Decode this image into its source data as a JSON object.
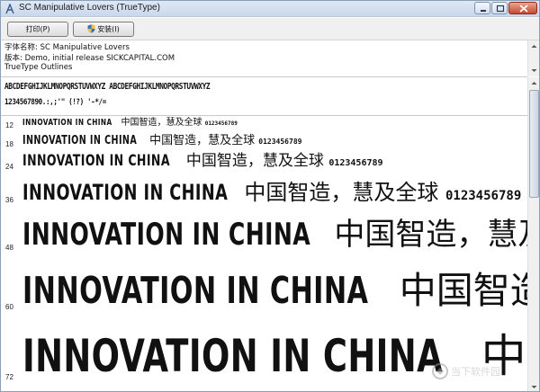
{
  "window": {
    "title": "SC Manipulative Lovers (TrueType)"
  },
  "toolbar": {
    "print_label": "打印(P)",
    "install_label": "安装(I)"
  },
  "info": {
    "font_name": "字体名称: SC Manipulative Lovers",
    "version": "版本: Demo, initial release SICKCAPITAL.COM",
    "outline": "TrueType Outlines"
  },
  "alphabet": {
    "line1": "ABCDEFGHIJKLMNOPQRSTUVWXYZ ABCDEFGHIJKLMNOPQRSTUVWXYZ",
    "line2": "1234567890.:,;'\" (!?) '-*/="
  },
  "samples": [
    {
      "size": "12",
      "latin": "INNOVATION IN CHINA",
      "cjk": "中国智造，慧及全球",
      "digits": "0123456789"
    },
    {
      "size": "18",
      "latin": "INNOVATION IN CHINA",
      "cjk": "中国智造，慧及全球",
      "digits": "0123456789"
    },
    {
      "size": "24",
      "latin": "INNOVATION IN CHINA",
      "cjk": "中国智造，慧及全球",
      "digits": "0123456789"
    },
    {
      "size": "36",
      "latin": "INNOVATION IN CHINA",
      "cjk": "中国智造，慧及全球",
      "digits": "0123456789"
    },
    {
      "size": "48",
      "latin": "INNOVATION IN CHINA",
      "cjk": "中国智造，慧及全",
      "digits": ""
    },
    {
      "size": "60",
      "latin": "INNOVATION IN CHINA",
      "cjk": "中国智造，",
      "digits": ""
    },
    {
      "size": "72",
      "latin": "INNOVATION IN CHINA",
      "cjk": "中国智",
      "digits": ""
    }
  ],
  "watermark": {
    "text": "当下软件园",
    "icon": "watermark-logo-icon"
  },
  "colors": {
    "titlebar": "#c9d8eb",
    "close_button": "#c44a30",
    "text": "#111111"
  }
}
